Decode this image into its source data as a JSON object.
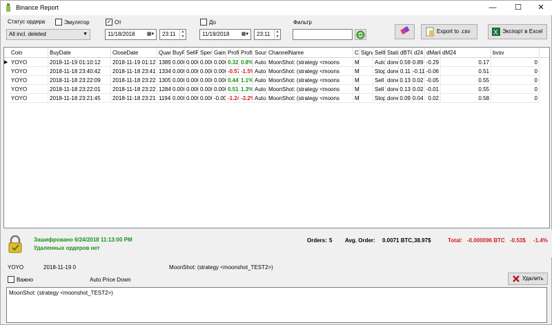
{
  "window": {
    "title": "Binance Report",
    "minimize": "—",
    "maximize": "☐",
    "close": "✕"
  },
  "filters": {
    "status_label": "Статус ордера",
    "status_value": "All incl. deleted",
    "emulator_label": "Эмулятор",
    "emulator_checked": false,
    "from_label": "От",
    "from_checked": true,
    "from_date": "11/18/2018",
    "from_time": "23:11",
    "to_label": "До",
    "to_checked": false,
    "to_date": "11/19/2018",
    "to_time": "23:11",
    "filter_label": "Фильтр",
    "filter_value": "",
    "export_csv": "Export to .csv",
    "export_excel": "Экспорт в Excel"
  },
  "table": {
    "columns": [
      "Coin",
      "BuyDate",
      "CloseDate",
      "Quar",
      "BuyP",
      "SellP",
      "Spen",
      "Gain",
      "Profi",
      "Profi",
      "Sour",
      "ChannelName",
      "Co",
      "Signa",
      "SellR",
      "Stati",
      "dBTC",
      "d24",
      "dMark",
      "dM24",
      "bvsv"
    ],
    "rows": [
      [
        "YOYO",
        "2018-11-19 01:10:12",
        "2018-11-19 01:12",
        "1389",
        "0.000",
        "0.000",
        "0.000",
        "0.000",
        "0.32",
        "0.8%",
        "Auto",
        "MoonShot: (strategy <moons",
        "M",
        "",
        "Auto",
        "done",
        "0.59",
        "0.89",
        "-0.29",
        "0.17",
        "0"
      ],
      [
        "YOYO",
        "2018-11-18 23:40:42",
        "2018-11-18 23:41",
        "1334",
        "0.000",
        "0.000",
        "0.000",
        "0.000",
        "-0.57",
        "-1.5%",
        "Auto",
        "MoonShot: (strategy <moons",
        "M",
        "",
        "StopL",
        "done",
        "0.11",
        "-0.11",
        "-0.06",
        "0.51",
        "0"
      ],
      [
        "YOYO",
        "2018-11-18 23:22:09",
        "2018-11-18 23:22",
        "1305",
        "0.000",
        "0.000",
        "0.000",
        "0.000",
        "0.44",
        "1.1%",
        "Auto",
        "MoonShot: (strategy <moons",
        "M",
        "",
        "Sell F",
        "done",
        "0.13",
        "0.02",
        "-0.05",
        "0.55",
        "0"
      ],
      [
        "YOYO",
        "2018-11-18 23:22:01",
        "2018-11-18 23:22",
        "1284",
        "0.000",
        "0.000",
        "0.000",
        "0.000",
        "0.51",
        "1.3%",
        "Auto",
        "MoonShot: (strategy <moons",
        "M",
        "",
        "Sell F",
        "done",
        "0.13",
        "0.02",
        "-0.01",
        "0.55",
        "0"
      ],
      [
        "YOYO",
        "2018-11-18 23:21:45",
        "2018-11-18 23:21",
        "1194",
        "0.000",
        "0.000",
        "0.000",
        "-0.00",
        "-1.24",
        "-3.2%",
        "Auto",
        "MoonShot: (strategy <moons",
        "M",
        "",
        "StopL",
        "done",
        "0.09",
        "0.04",
        "0.02",
        "0.58",
        "0"
      ]
    ]
  },
  "status": {
    "encrypted": "Зашифровано 6/24/2018 11:13:00 PM",
    "deleted": "Удаленных ордеров нет",
    "orders_label": "Orders:",
    "orders_value": "5",
    "avg_label": "Avg. Order:",
    "avg_btc": "0.0071 BTC,",
    "avg_usd": "38.97$",
    "total_label": "Total:",
    "total_btc": "-0.000096 BTC",
    "total_usd": "-0.53$",
    "total_pct": "-1.4%"
  },
  "detail": {
    "coin": "YOYO",
    "date": "2018-11-19 0",
    "channel": "MoonShot: (strategy <moonshot_TEST2>)",
    "important_label": "Важно",
    "important_checked": false,
    "mode": "Auto Price Down",
    "delete_label": "Удалить",
    "comment": "MoonShot: (strategy <moonshot_TEST2>)"
  },
  "colors": {
    "profit": "#1a8f1a",
    "loss": "#d21b1b"
  }
}
